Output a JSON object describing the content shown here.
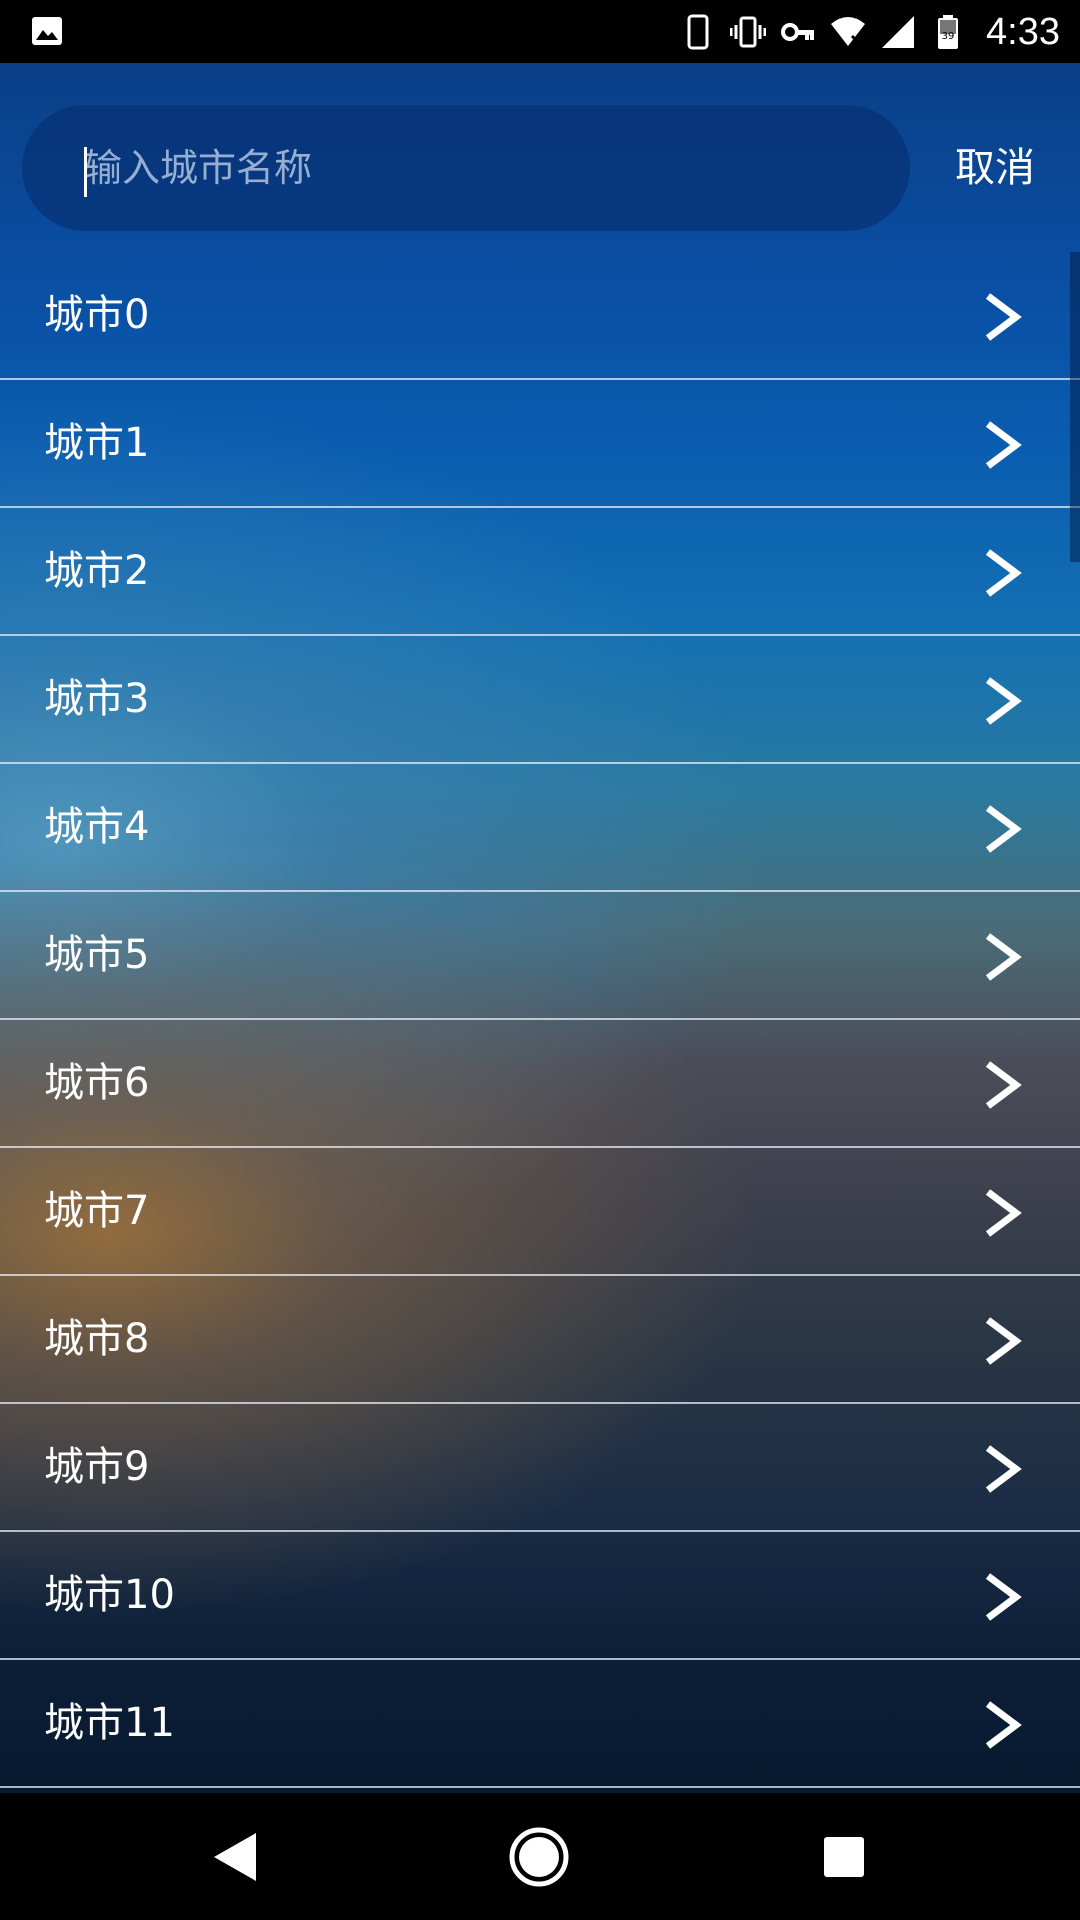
{
  "status_bar": {
    "time": "4:33",
    "battery_level": "39",
    "icons": [
      "image-icon",
      "phone-icon",
      "vibrate-icon",
      "vpn-key-icon",
      "wifi-icon",
      "signal-icon",
      "battery-icon"
    ]
  },
  "search": {
    "placeholder": "输入城市名称",
    "value": "",
    "cancel_label": "取消"
  },
  "cities": [
    {
      "label": "城市0"
    },
    {
      "label": "城市1"
    },
    {
      "label": "城市2"
    },
    {
      "label": "城市3"
    },
    {
      "label": "城市4"
    },
    {
      "label": "城市5"
    },
    {
      "label": "城市6"
    },
    {
      "label": "城市7"
    },
    {
      "label": "城市8"
    },
    {
      "label": "城市9"
    },
    {
      "label": "城市10"
    },
    {
      "label": "城市11"
    }
  ],
  "nav_bar": {
    "icons": [
      "back-icon",
      "home-icon",
      "recents-icon"
    ]
  },
  "colors": {
    "top_blue": "#0a4ea3",
    "bottom_navy": "#0c1e36",
    "warm_accent": "#7a6040",
    "divider": "#e6ebf5"
  }
}
